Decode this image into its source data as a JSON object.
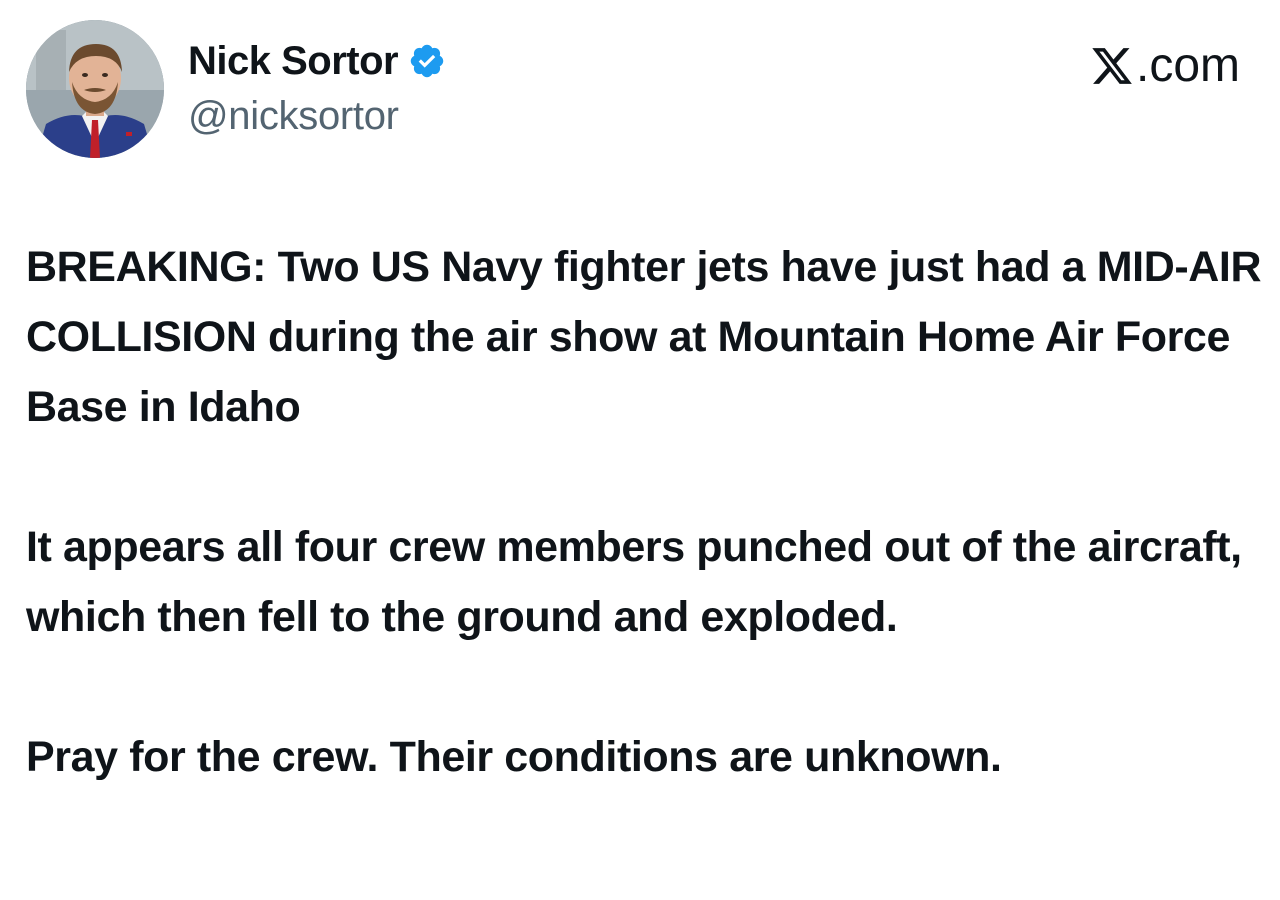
{
  "author": {
    "display_name": "Nick Sortor",
    "handle": "@nicksortor",
    "verified": true,
    "avatar_icon": "profile-photo"
  },
  "brand": {
    "label": ".com",
    "logo_icon": "x-logo-icon"
  },
  "tweet": {
    "paragraphs": [
      "BREAKING: Two US Navy fighter jets have just had a MID-AIR COLLISION during the air show at Mountain Home Air Force Base in Idaho",
      "It appears all four crew members punched out of the aircraft, which then fell to the ground and exploded.",
      "Pray for the crew. Their conditions are unknown."
    ]
  },
  "colors": {
    "text": "#0f1419",
    "secondary_text": "#536471",
    "verified_badge": "#1d9bf0",
    "background": "#ffffff"
  }
}
